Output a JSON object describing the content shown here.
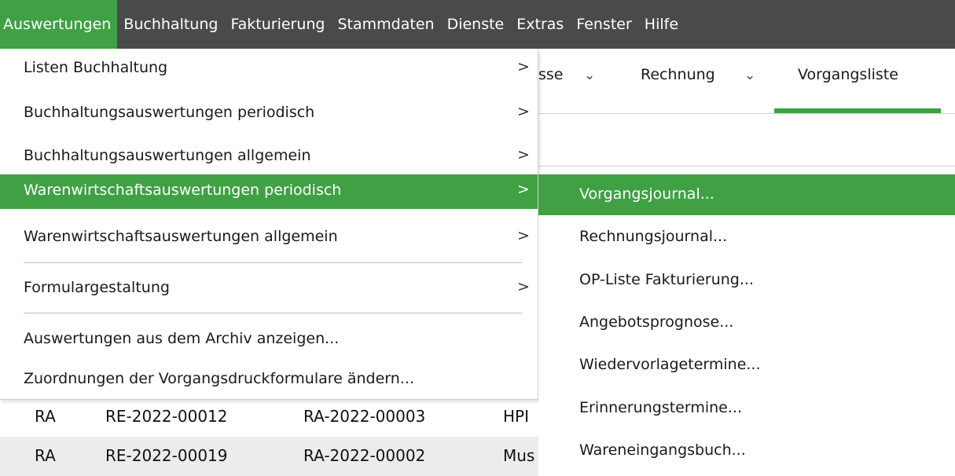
{
  "menubar": {
    "items": [
      "Auswertungen",
      "Buchhaltung",
      "Fakturierung",
      "Stammdaten",
      "Dienste",
      "Extras",
      "Fenster",
      "Hilfe"
    ],
    "active_color": "#3fa143",
    "bg_color": "#4a4a4a"
  },
  "tabs": {
    "partial": "sse",
    "rechnung": "Rechnung",
    "vorgangsliste": "Vorgangsliste",
    "chevron": "⌄"
  },
  "menu1": {
    "items": [
      {
        "label": "Listen Buchhaltung",
        "arrow": ">"
      },
      {
        "label": "Buchhaltungsauswertungen periodisch",
        "arrow": ">"
      },
      {
        "label": "Buchhaltungsauswertungen allgemein",
        "arrow": ">"
      },
      {
        "label": "Warenwirtschaftsauswertungen periodisch",
        "arrow": ">"
      },
      {
        "label": "Warenwirtschaftsauswertungen allgemein",
        "arrow": ">"
      },
      {
        "label": "Formulargestaltung",
        "arrow": ">"
      },
      {
        "label": "Auswertungen aus dem Archiv anzeigen..."
      },
      {
        "label": "Zuordnungen der Vorgangsdruckformulare ändern..."
      }
    ]
  },
  "menu2": {
    "items": [
      "Vorgangsjournal...",
      "Rechnungsjournal...",
      "OP-Liste Fakturierung...",
      "Angebotsprognose...",
      "Wiedervorlagetermine...",
      "Erinnerungstermine...",
      "Wareneingangsbuch..."
    ]
  },
  "table": {
    "rows": [
      [
        "RA",
        "RE-2022-00012",
        "RA-2022-00003",
        "HPI"
      ],
      [
        "RA",
        "RE-2022-00019",
        "RA-2022-00002",
        "Mus"
      ]
    ]
  }
}
